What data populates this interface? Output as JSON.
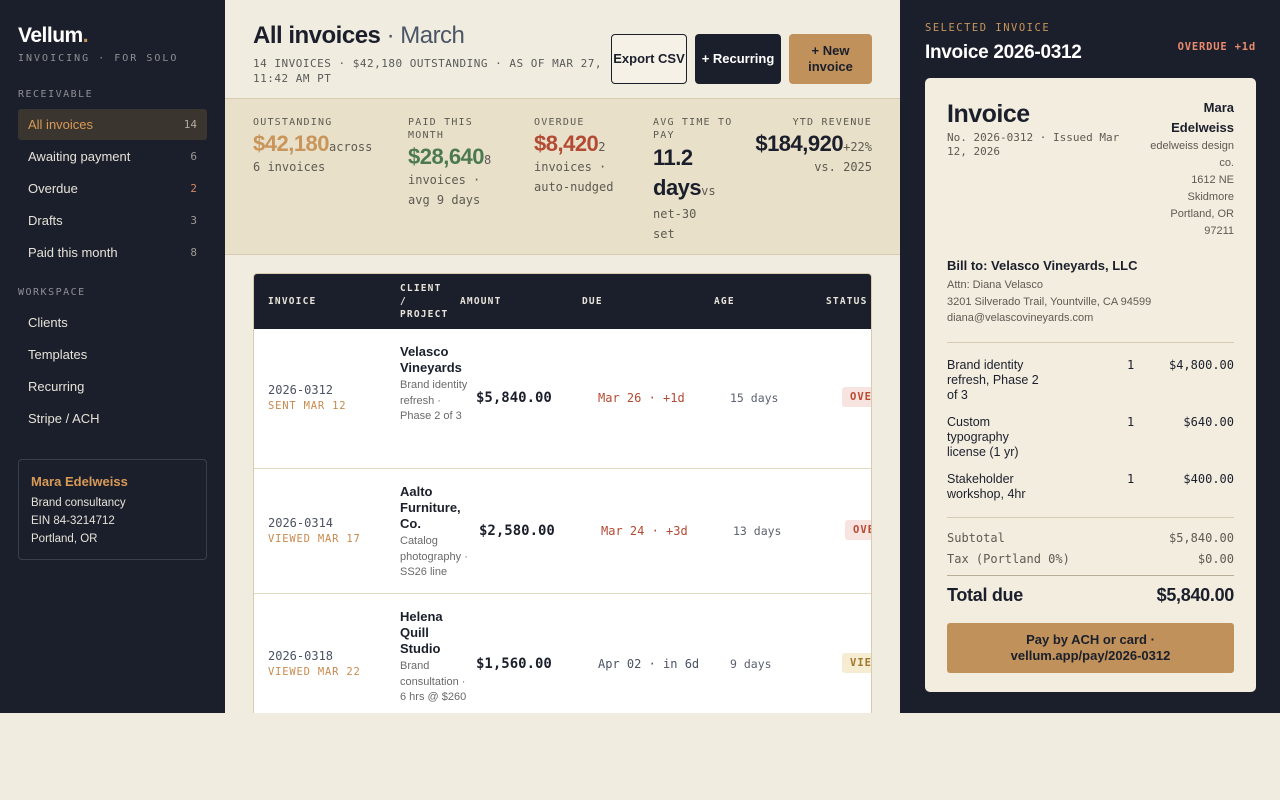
{
  "sidebar": {
    "brand": "Vellum",
    "brand_dot": ".",
    "tagline": "INVOICING · FOR SOLO",
    "section_receivable": "RECEIVABLE",
    "section_workspace": "WORKSPACE",
    "receivable_items": [
      {
        "label": "All invoices",
        "count": "14"
      },
      {
        "label": "Awaiting payment",
        "count": "6"
      },
      {
        "label": "Overdue",
        "count": "2"
      },
      {
        "label": "Drafts",
        "count": "3"
      },
      {
        "label": "Paid this month",
        "count": "8"
      }
    ],
    "workspace_items": [
      {
        "label": "Clients"
      },
      {
        "label": "Templates"
      },
      {
        "label": "Recurring"
      },
      {
        "label": "Stripe / ACH"
      }
    ],
    "profile": {
      "name": "Mara Edelweiss",
      "line1": "Brand consultancy",
      "line2": "EIN 84-3214712",
      "line3": "Portland, OR"
    }
  },
  "header": {
    "title": "All invoices",
    "month": "· March",
    "subtitle": "14 INVOICES · $42,180 OUTSTANDING · AS OF MAR 27, 11:42 AM PT",
    "export_label": "Export CSV",
    "recurring_label": "+ Recurring",
    "new_label": "+ New invoice"
  },
  "stats": {
    "outstanding": {
      "label": "OUTSTANDING",
      "value": "$42,180",
      "suffix": "across",
      "note": "6 invoices",
      "color": "#c8955a"
    },
    "paid": {
      "label": "PAID THIS MONTH",
      "value": "$28,640",
      "suffix": "8",
      "note": "invoices · avg 9 days",
      "color": "#4c7a4f"
    },
    "overdue": {
      "label": "OVERDUE",
      "value": "$8,420",
      "suffix": "2",
      "note": "invoices · auto-nudged",
      "color": "#b34a33"
    },
    "avg": {
      "label": "AVG TIME TO PAY",
      "value": "11.2 days",
      "suffix": "vs",
      "note": "net-30 set"
    },
    "ytd": {
      "label": "YTD REVENUE",
      "value": "$184,920",
      "suffix": "+22%",
      "note": "vs. 2025"
    }
  },
  "table": {
    "headers": {
      "invoice": "INVOICE",
      "client": "CLIENT / PROJECT",
      "amount": "AMOUNT",
      "due": "DUE",
      "age": "AGE",
      "status": "STATUS"
    },
    "rows": [
      {
        "id": "2026-0312",
        "sent": "SENT MAR 12",
        "client": "Velasco Vineyards",
        "project": "Brand identity refresh · Phase 2 of 3",
        "amount": "$5,840.00",
        "due": "Mar 26 · +1d",
        "age": "15 days",
        "status": "OVERDUE",
        "status_kind": "overdue"
      },
      {
        "id": "2026-0314",
        "sent": "VIEWED MAR 17",
        "client": "Aalto Furniture, Co.",
        "project": "Catalog photography · SS26 line",
        "amount": "$2,580.00",
        "due": "Mar 24 · +3d",
        "age": "13 days",
        "status": "OVERDUE",
        "status_kind": "overdue"
      },
      {
        "id": "2026-0318",
        "sent": "VIEWED MAR 22",
        "client": "Helena Quill Studio",
        "project": "Brand consultation · 6 hrs @ $260",
        "amount": "$1,560.00",
        "due": "Apr 02 · in 6d",
        "age": "9 days",
        "status": "VIEWED",
        "status_kind": "viewed"
      }
    ]
  },
  "panel": {
    "label": "SELECTED INVOICE",
    "title": "Invoice 2026-0312",
    "status": "OVERDUE +1d",
    "doc": {
      "heading": "Invoice",
      "number": "No. 2026-0312 · Issued Mar 12, 2026",
      "from_name": "Mara Edelweiss",
      "from_lines": [
        "edelweiss design co.",
        "1612 NE Skidmore",
        "Portland, OR 97211"
      ],
      "bill_to": "Bill to: Velasco Vineyards, LLC",
      "attn": "Attn: Diana Velasco",
      "address": "3201 Silverado Trail, Yountville, CA 94599",
      "email": "diana@velascovineyards.com",
      "items": [
        {
          "desc": "Brand identity refresh, Phase 2 of 3",
          "qty": "1",
          "amount": "$4,800.00"
        },
        {
          "desc": "Custom typography license (1 yr)",
          "qty": "1",
          "amount": "$640.00"
        },
        {
          "desc": "Stakeholder workshop, 4hr",
          "qty": "1",
          "amount": "$400.00"
        }
      ],
      "subtotal_label": "Subtotal",
      "subtotal": "$5,840.00",
      "tax_label": "Tax (Portland 0%)",
      "tax": "$0.00",
      "total_label": "Total due",
      "total": "$5,840.00",
      "pay_label": "Pay by ACH or card · vellum.app/pay/2026-0312"
    }
  }
}
